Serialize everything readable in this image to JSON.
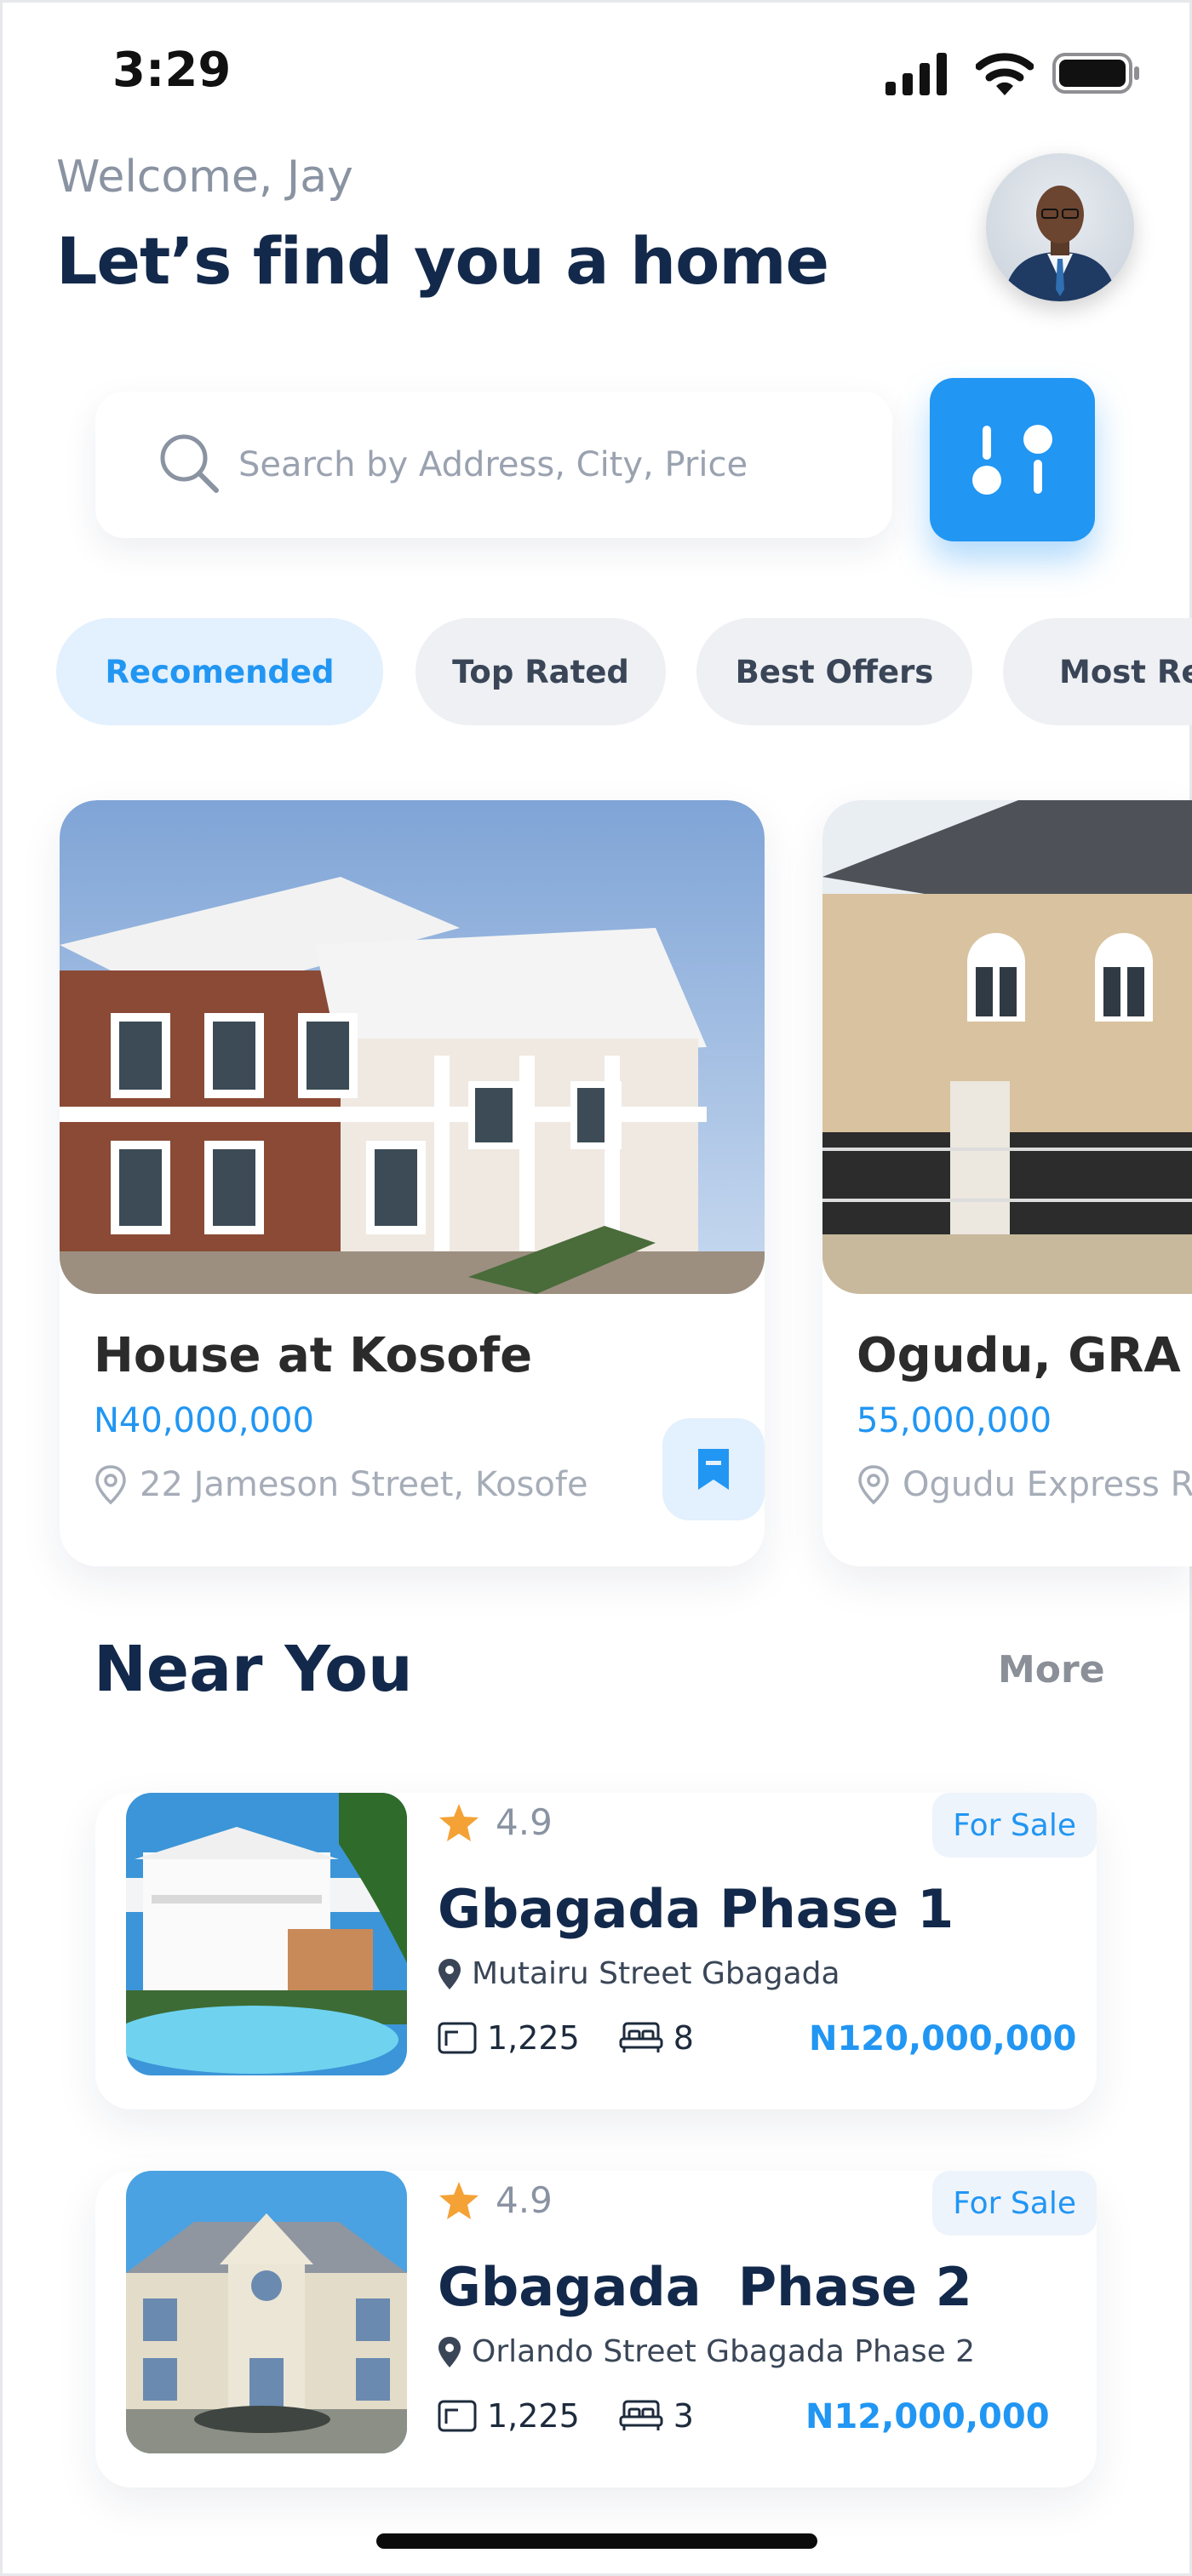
{
  "status_bar": {
    "time": "3:29"
  },
  "header": {
    "welcome": "Welcome, Jay",
    "headline": "Let’s find you a home"
  },
  "search": {
    "placeholder": "Search by Address, City, Price"
  },
  "tabs": [
    {
      "label": "Recomended",
      "active": true
    },
    {
      "label": "Top Rated",
      "active": false
    },
    {
      "label": "Best Offers",
      "active": false
    },
    {
      "label": "Most Re",
      "active": false
    }
  ],
  "properties": [
    {
      "title": "House at Kosofe",
      "price": "N40,000,000",
      "address": "22 Jameson Street, Kosofe"
    },
    {
      "title": "Ogudu, GRA",
      "price": "55,000,000",
      "address": "Ogudu Express R"
    }
  ],
  "near_you": {
    "title": "Near You",
    "more": "More",
    "items": [
      {
        "rating": "4.9",
        "badge": "For Sale",
        "title": "Gbagada Phase 1",
        "location": "Mutairu Street Gbagada",
        "area": "1,225",
        "beds": "8",
        "price": "N120,000,000"
      },
      {
        "rating": "4.9",
        "badge": "For Sale",
        "title": "Gbagada  Phase 2",
        "location": "Orlando Street Gbagada Phase 2",
        "area": "1,225",
        "beds": "3",
        "price": "N12,000,000"
      }
    ]
  },
  "colors": {
    "accent": "#2196f3",
    "heading": "#13294b",
    "star": "#f4a236"
  }
}
